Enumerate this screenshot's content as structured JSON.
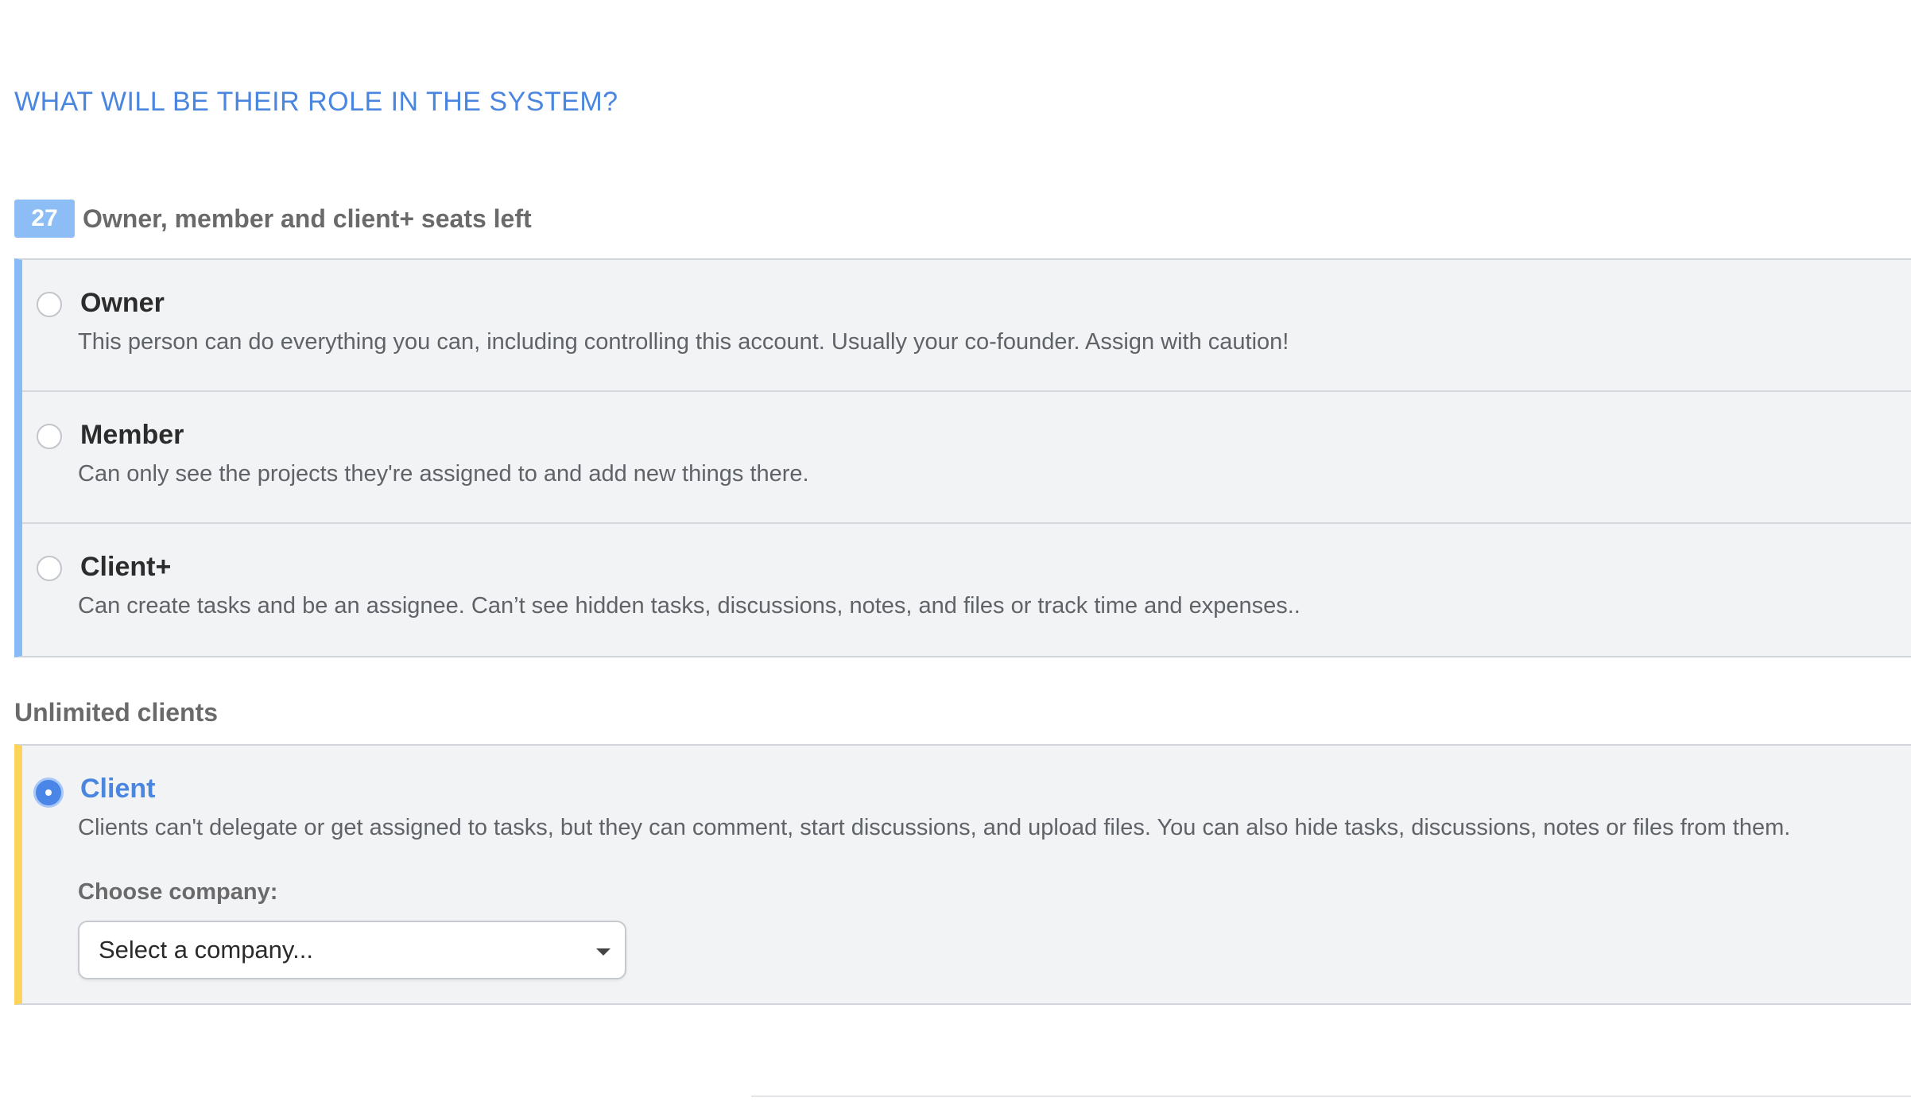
{
  "heading": "WHAT WILL BE THEIR ROLE IN THE SYSTEM?",
  "seats": {
    "count": "27",
    "label": "Owner, member and client+ seats left"
  },
  "roles": [
    {
      "title": "Owner",
      "description": "This person can do everything you can, including controlling this account. Usually your co-founder. Assign with caution!",
      "selected": false
    },
    {
      "title": "Member",
      "description": "Can only see the projects they're assigned to and add new things there.",
      "selected": false
    },
    {
      "title": "Client+",
      "description": "Can create tasks and be an assignee. Can’t see hidden tasks, discussions, notes, and files or track time and expenses..",
      "selected": false
    }
  ],
  "unlimited": {
    "label": "Unlimited clients",
    "client": {
      "title": "Client",
      "description": "Clients can't delegate or get assigned to tasks, but they can comment, start discussions, and upload files. You can also hide tasks, discussions, notes or files from them.",
      "selected": true
    },
    "choose_company_label": "Choose company:",
    "company_select_value": "Select a company..."
  },
  "colors": {
    "accent": "#4a86e0",
    "seat_badge": "#8cbef5",
    "paid_group_border": "#88bbf6",
    "client_group_border": "#fbd55a",
    "panel_background": "#f2f3f5"
  },
  "icons": {
    "radio_unchecked": "radio-unchecked-icon",
    "radio_checked": "radio-checked-icon",
    "select_caret": "caret-down-icon"
  }
}
